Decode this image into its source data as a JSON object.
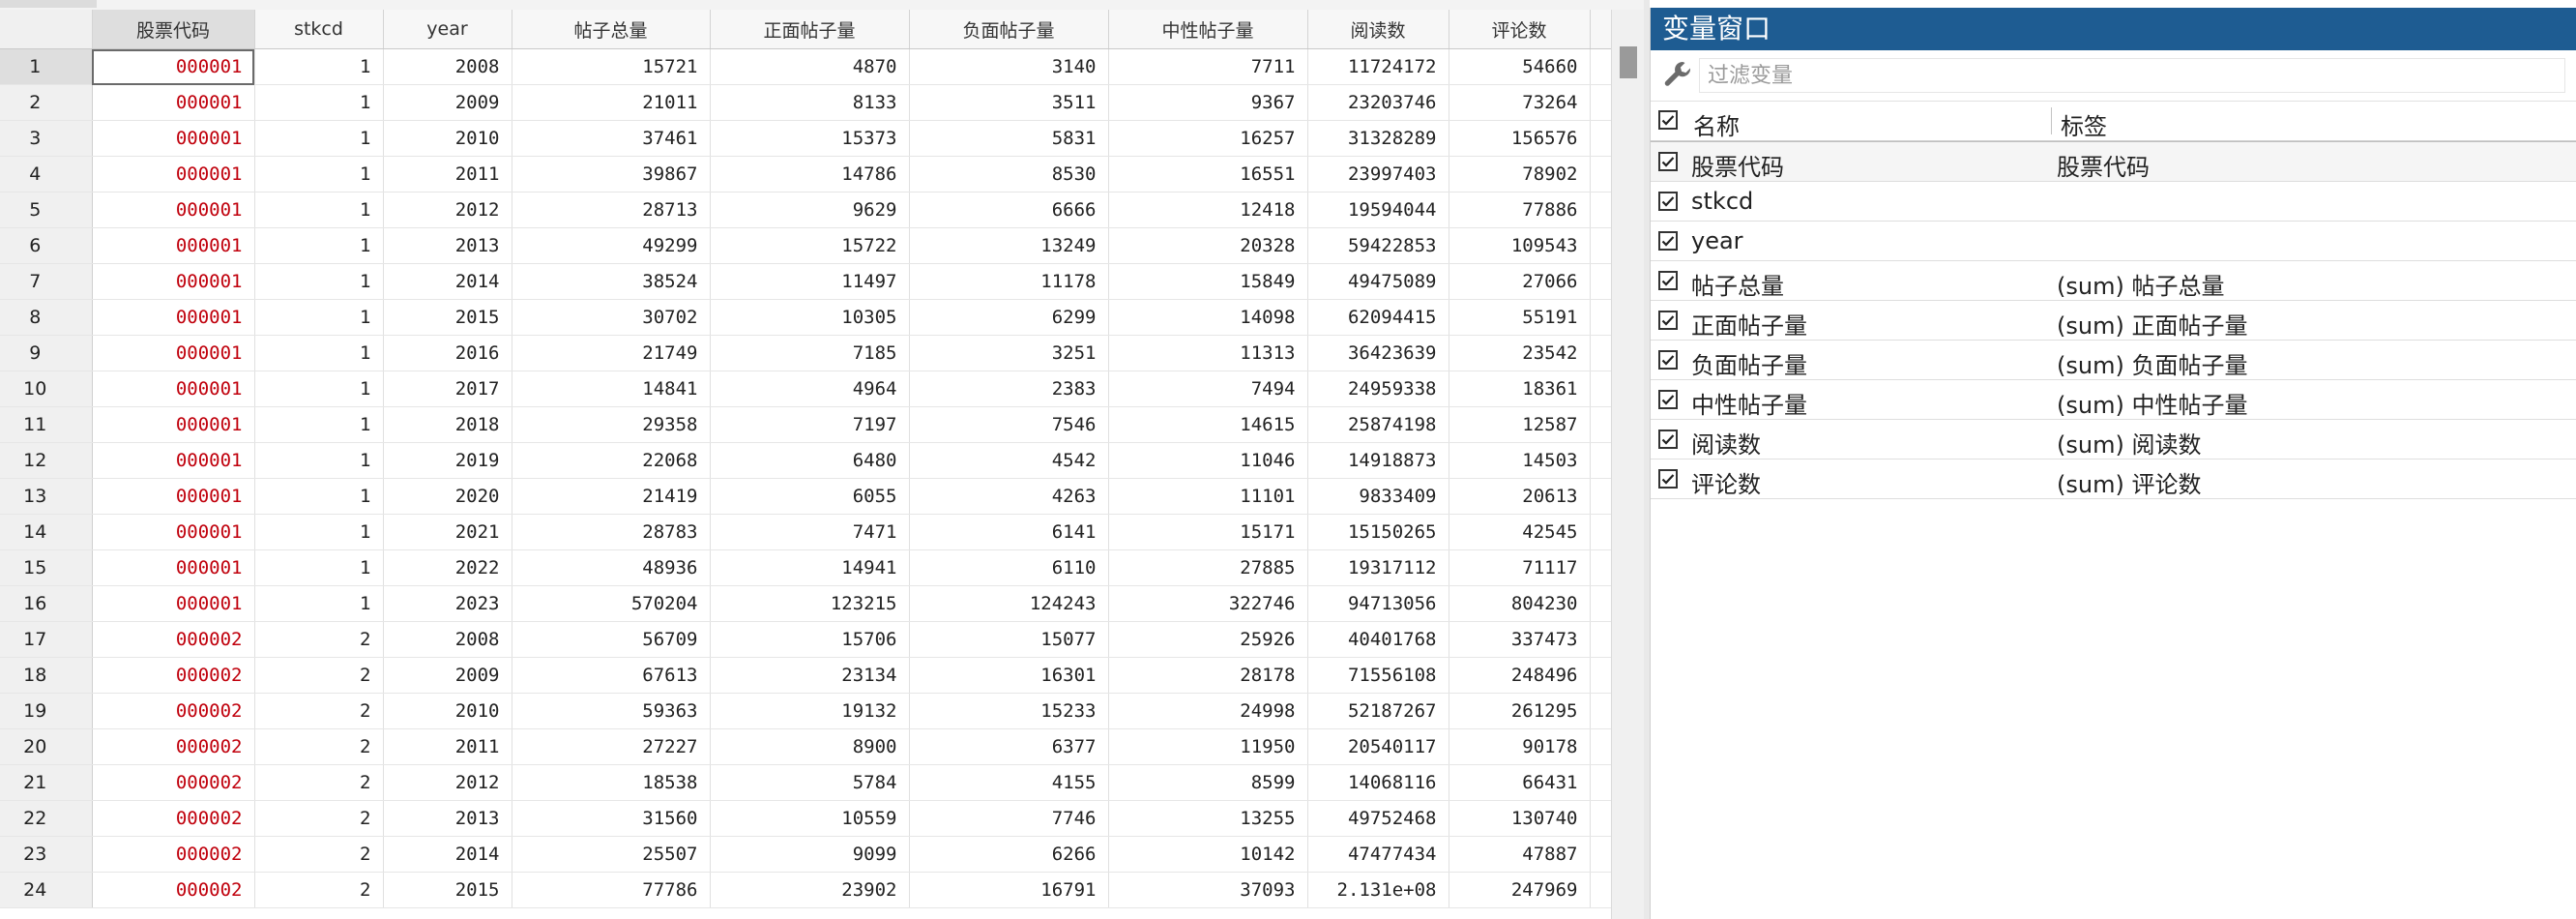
{
  "grid": {
    "columns": [
      "",
      "股票代码",
      "stkcd",
      "year",
      "帖子总量",
      "正面帖子量",
      "负面帖子量",
      "中性帖子量",
      "阅读数",
      "评论数"
    ],
    "rows": [
      [
        "1",
        "000001",
        "1",
        "2008",
        "15721",
        "4870",
        "3140",
        "7711",
        "11724172",
        "54660"
      ],
      [
        "2",
        "000001",
        "1",
        "2009",
        "21011",
        "8133",
        "3511",
        "9367",
        "23203746",
        "73264"
      ],
      [
        "3",
        "000001",
        "1",
        "2010",
        "37461",
        "15373",
        "5831",
        "16257",
        "31328289",
        "156576"
      ],
      [
        "4",
        "000001",
        "1",
        "2011",
        "39867",
        "14786",
        "8530",
        "16551",
        "23997403",
        "78902"
      ],
      [
        "5",
        "000001",
        "1",
        "2012",
        "28713",
        "9629",
        "6666",
        "12418",
        "19594044",
        "77886"
      ],
      [
        "6",
        "000001",
        "1",
        "2013",
        "49299",
        "15722",
        "13249",
        "20328",
        "59422853",
        "109543"
      ],
      [
        "7",
        "000001",
        "1",
        "2014",
        "38524",
        "11497",
        "11178",
        "15849",
        "49475089",
        "27066"
      ],
      [
        "8",
        "000001",
        "1",
        "2015",
        "30702",
        "10305",
        "6299",
        "14098",
        "62094415",
        "55191"
      ],
      [
        "9",
        "000001",
        "1",
        "2016",
        "21749",
        "7185",
        "3251",
        "11313",
        "36423639",
        "23542"
      ],
      [
        "10",
        "000001",
        "1",
        "2017",
        "14841",
        "4964",
        "2383",
        "7494",
        "24959338",
        "18361"
      ],
      [
        "11",
        "000001",
        "1",
        "2018",
        "29358",
        "7197",
        "7546",
        "14615",
        "25874198",
        "12587"
      ],
      [
        "12",
        "000001",
        "1",
        "2019",
        "22068",
        "6480",
        "4542",
        "11046",
        "14918873",
        "14503"
      ],
      [
        "13",
        "000001",
        "1",
        "2020",
        "21419",
        "6055",
        "4263",
        "11101",
        "9833409",
        "20613"
      ],
      [
        "14",
        "000001",
        "1",
        "2021",
        "28783",
        "7471",
        "6141",
        "15171",
        "15150265",
        "42545"
      ],
      [
        "15",
        "000001",
        "1",
        "2022",
        "48936",
        "14941",
        "6110",
        "27885",
        "19317112",
        "71117"
      ],
      [
        "16",
        "000001",
        "1",
        "2023",
        "570204",
        "123215",
        "124243",
        "322746",
        "94713056",
        "804230"
      ],
      [
        "17",
        "000002",
        "2",
        "2008",
        "56709",
        "15706",
        "15077",
        "25926",
        "40401768",
        "337473"
      ],
      [
        "18",
        "000002",
        "2",
        "2009",
        "67613",
        "23134",
        "16301",
        "28178",
        "71556108",
        "248496"
      ],
      [
        "19",
        "000002",
        "2",
        "2010",
        "59363",
        "19132",
        "15233",
        "24998",
        "52187267",
        "261295"
      ],
      [
        "20",
        "000002",
        "2",
        "2011",
        "27227",
        "8900",
        "6377",
        "11950",
        "20540117",
        "90178"
      ],
      [
        "21",
        "000002",
        "2",
        "2012",
        "18538",
        "5784",
        "4155",
        "8599",
        "14068116",
        "66431"
      ],
      [
        "22",
        "000002",
        "2",
        "2013",
        "31560",
        "10559",
        "7746",
        "13255",
        "49752468",
        "130740"
      ],
      [
        "23",
        "000002",
        "2",
        "2014",
        "25507",
        "9099",
        "6266",
        "10142",
        "47477434",
        "47887"
      ],
      [
        "24",
        "000002",
        "2",
        "2015",
        "77786",
        "23902",
        "16791",
        "37093",
        "2.131e+08",
        "247969"
      ]
    ]
  },
  "variables_window": {
    "title": "变量窗口",
    "filter_placeholder": "过滤变量",
    "header_name": "名称",
    "header_label": "标签",
    "variables": [
      {
        "name": "股票代码",
        "label": "股票代码"
      },
      {
        "name": "stkcd",
        "label": ""
      },
      {
        "name": "year",
        "label": ""
      },
      {
        "name": "帖子总量",
        "label": "(sum) 帖子总量"
      },
      {
        "name": "正面帖子量",
        "label": "(sum) 正面帖子量"
      },
      {
        "name": "负面帖子量",
        "label": "(sum) 负面帖子量"
      },
      {
        "name": "中性帖子量",
        "label": "(sum) 中性帖子量"
      },
      {
        "name": "阅读数",
        "label": "(sum) 阅读数"
      },
      {
        "name": "评论数",
        "label": "(sum) 评论数"
      }
    ]
  },
  "colors": {
    "title_bar": "#1e5c92",
    "code_text": "#c0000c"
  },
  "icons": {
    "filter": "wrench-icon",
    "checkbox": "checkmark-icon"
  }
}
